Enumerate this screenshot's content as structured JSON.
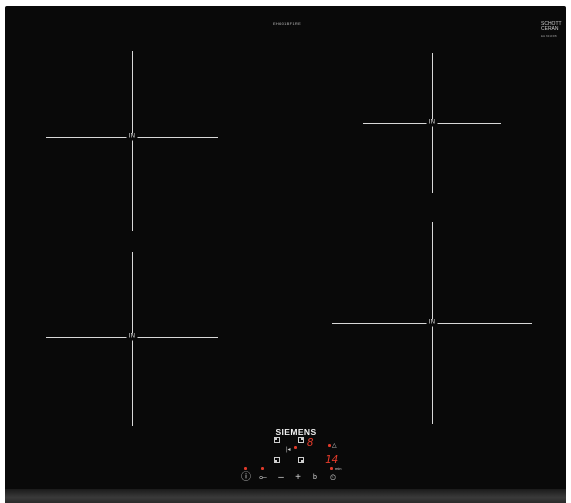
{
  "model_label": "EH601BF1RE",
  "glass_brand": "SCHOTT",
  "glass_brand_line2": "CERAN",
  "glass_sub": "EH 631FFB",
  "brand": "SIEMENS",
  "zone_label": "IN",
  "display": {
    "power_level": "8",
    "timer_value": "14",
    "timer_unit": "min"
  },
  "controls": {
    "power_symbol": "ⓘ",
    "lock_symbol": "⟜",
    "minus": "–",
    "plus": "+",
    "boost": "b",
    "timer_symbol": "⏲",
    "bell_symbol": "△",
    "boost_flex": "|◂"
  },
  "colors": {
    "glass": "#090909",
    "lines": "#d8d8d8",
    "indicator": "#e23a2a"
  }
}
